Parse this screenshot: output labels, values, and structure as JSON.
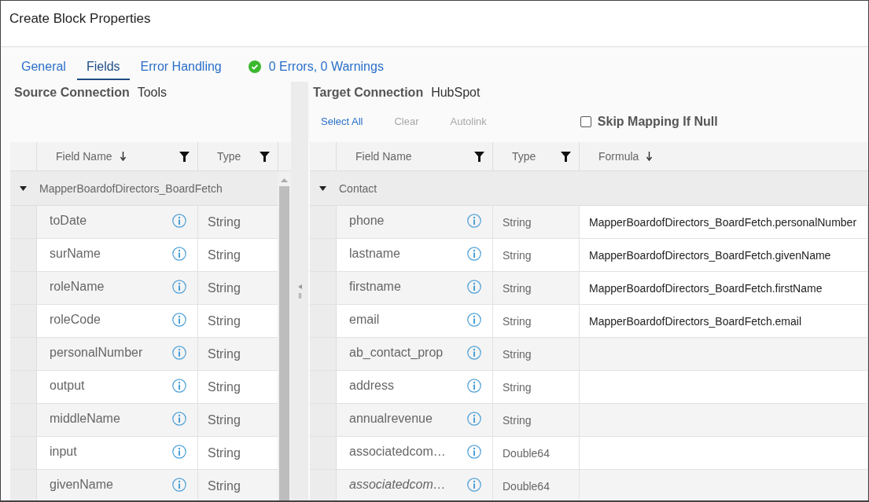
{
  "window": {
    "title": "Create Block Properties"
  },
  "tabs": [
    {
      "label": "General",
      "selected": false
    },
    {
      "label": "Fields",
      "selected": true
    },
    {
      "label": "Error Handling",
      "selected": false
    }
  ],
  "status": {
    "text": "0 Errors, 0 Warnings"
  },
  "source": {
    "label": "Source Connection",
    "value": "Tools",
    "columns": [
      {
        "label": "Field Name",
        "sorted": true,
        "filter": true
      },
      {
        "label": "Type",
        "sorted": false,
        "filter": true
      }
    ],
    "group": {
      "label": "MapperBoardofDirectors_BoardFetch",
      "expanded": true
    },
    "rows": [
      {
        "name": "toDate",
        "type": "String"
      },
      {
        "name": "surName",
        "type": "String"
      },
      {
        "name": "roleName",
        "type": "String"
      },
      {
        "name": "roleCode",
        "type": "String"
      },
      {
        "name": "personalNumber",
        "type": "String"
      },
      {
        "name": "output",
        "type": "String"
      },
      {
        "name": "middleName",
        "type": "String"
      },
      {
        "name": "input",
        "type": "String"
      },
      {
        "name": "givenName",
        "type": "String"
      }
    ]
  },
  "target": {
    "label": "Target Connection",
    "value": "HubSpot",
    "toolbar": [
      {
        "label": "Select All",
        "disabled": false
      },
      {
        "label": "Clear",
        "disabled": true
      },
      {
        "label": "Autolink",
        "disabled": true
      }
    ],
    "skip_null": {
      "label": "Skip Mapping If Null",
      "checked": false
    },
    "columns": [
      {
        "label": "Field Name",
        "sorted": false,
        "filter": true
      },
      {
        "label": "Type",
        "sorted": false,
        "filter": true
      },
      {
        "label": "Formula",
        "sorted": true,
        "filter": false
      }
    ],
    "group": {
      "label": "Contact",
      "expanded": true
    },
    "rows": [
      {
        "name": "phone",
        "type": "String",
        "formula": "MapperBoardofDirectors_BoardFetch.personalNumber",
        "italic": false
      },
      {
        "name": "lastname",
        "type": "String",
        "formula": "MapperBoardofDirectors_BoardFetch.givenName",
        "italic": false
      },
      {
        "name": "firstname",
        "type": "String",
        "formula": "MapperBoardofDirectors_BoardFetch.firstName",
        "italic": false
      },
      {
        "name": "email",
        "type": "String",
        "formula": "MapperBoardofDirectors_BoardFetch.email",
        "italic": false
      },
      {
        "name": "ab_contact_prop",
        "type": "String",
        "italic": false
      },
      {
        "name": "address",
        "type": "String",
        "italic": false
      },
      {
        "name": "annualrevenue",
        "type": "String",
        "italic": false
      },
      {
        "name": "associatedcom…",
        "type": "Double64",
        "italic": false
      },
      {
        "name": "associatedcom…",
        "type": "Double64",
        "italic": true
      }
    ]
  }
}
